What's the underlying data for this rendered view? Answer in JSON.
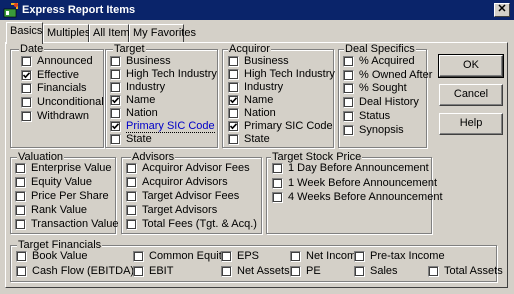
{
  "window": {
    "title": "Express Report Items",
    "close_glyph": "✕"
  },
  "tabs": [
    {
      "label": "Basics",
      "active": true
    },
    {
      "label": "Multiples",
      "active": false
    },
    {
      "label": "All Items",
      "active": false
    },
    {
      "label": "My Favorites",
      "active": false
    }
  ],
  "buttons": {
    "ok": "OK",
    "cancel": "Cancel",
    "help": "Help"
  },
  "groups": {
    "date": {
      "title": "Date",
      "items": [
        {
          "label": "Announced",
          "checked": false
        },
        {
          "label": "Effective",
          "checked": true
        },
        {
          "label": "Financials",
          "checked": false
        },
        {
          "label": "Unconditional",
          "checked": false
        },
        {
          "label": "Withdrawn",
          "checked": false
        }
      ]
    },
    "target": {
      "title": "Target",
      "items": [
        {
          "label": "Business",
          "checked": false
        },
        {
          "label": "High Tech Industry",
          "checked": false
        },
        {
          "label": "Industry",
          "checked": false
        },
        {
          "label": "Name",
          "checked": true
        },
        {
          "label": "Nation",
          "checked": false
        },
        {
          "label": "Primary SIC Code",
          "checked": true,
          "focused": true
        },
        {
          "label": "State",
          "checked": false
        }
      ]
    },
    "acquiror": {
      "title": "Acquiror",
      "items": [
        {
          "label": "Business",
          "checked": false
        },
        {
          "label": "High Tech Industry",
          "checked": false
        },
        {
          "label": "Industry",
          "checked": false
        },
        {
          "label": "Name",
          "checked": true
        },
        {
          "label": "Nation",
          "checked": false
        },
        {
          "label": "Primary SIC Code",
          "checked": true
        },
        {
          "label": "State",
          "checked": false
        }
      ]
    },
    "deal": {
      "title": "Deal Specifics",
      "items": [
        {
          "label": "% Acquired",
          "checked": false
        },
        {
          "label": "% Owned After",
          "checked": false
        },
        {
          "label": "% Sought",
          "checked": false
        },
        {
          "label": "Deal History",
          "checked": false
        },
        {
          "label": "Status",
          "checked": false
        },
        {
          "label": "Synopsis",
          "checked": false
        }
      ]
    },
    "valuation": {
      "title": "Valuation",
      "items": [
        {
          "label": "Enterprise Value",
          "checked": false
        },
        {
          "label": "Equity Value",
          "checked": false
        },
        {
          "label": "Price Per Share",
          "checked": false
        },
        {
          "label": "Rank Value",
          "checked": false
        },
        {
          "label": "Transaction Value",
          "checked": false
        }
      ]
    },
    "advisors": {
      "title": "Advisors",
      "items": [
        {
          "label": "Acquiror Advisor Fees",
          "checked": false
        },
        {
          "label": "Acquiror Advisors",
          "checked": false
        },
        {
          "label": "Target Advisor Fees",
          "checked": false
        },
        {
          "label": "Target Advisors",
          "checked": false
        },
        {
          "label": "Total Fees (Tgt. & Acq.)",
          "checked": false
        }
      ]
    },
    "stock": {
      "title": "Target Stock Price",
      "items": [
        {
          "label": "1 Day Before Announcement",
          "checked": false
        },
        {
          "label": "1 Week Before Announcement",
          "checked": false
        },
        {
          "label": "4 Weeks Before Announcement",
          "checked": false
        }
      ]
    },
    "financials": {
      "title": "Target Financials",
      "items": [
        {
          "label": "Book Value",
          "checked": false
        },
        {
          "label": "Common Equity",
          "checked": false
        },
        {
          "label": "EPS",
          "checked": false
        },
        {
          "label": "Net Income",
          "checked": false
        },
        {
          "label": "Pre-tax Income",
          "checked": false
        },
        {
          "label": "Cash Flow (EBITDA)",
          "checked": false
        },
        {
          "label": "EBIT",
          "checked": false
        },
        {
          "label": "Net Assets",
          "checked": false
        },
        {
          "label": "PE",
          "checked": false
        },
        {
          "label": "Sales",
          "checked": false
        },
        {
          "label": "Total Assets",
          "checked": false
        }
      ]
    }
  },
  "icons": {
    "window": "report-app-icon",
    "check": "check-icon"
  },
  "colors": {
    "titlebar": "#0a246a",
    "face": "#d4d0c8",
    "focus_text": "#0000c8"
  }
}
